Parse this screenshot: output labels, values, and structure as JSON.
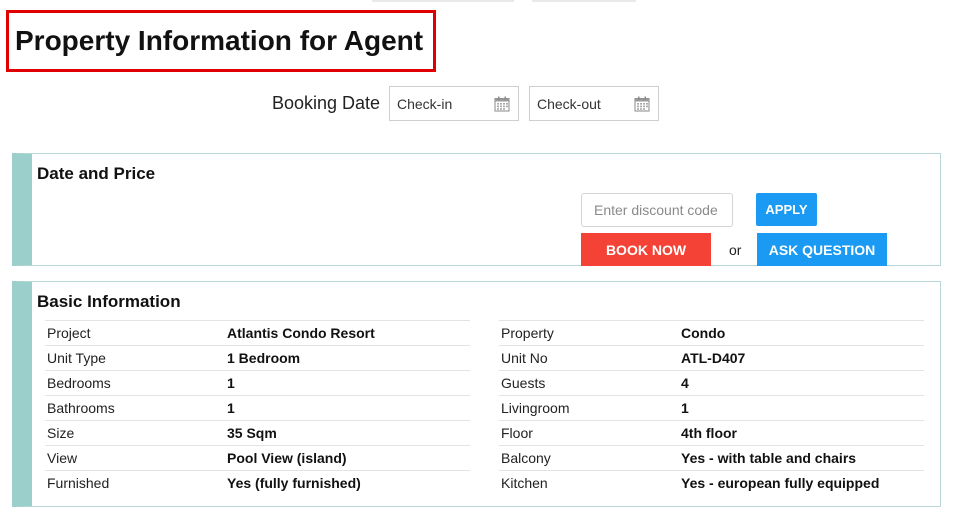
{
  "page": {
    "title": "Property Information for Agent"
  },
  "booking": {
    "label": "Booking Date",
    "checkin": "Check-in",
    "checkout": "Check-out"
  },
  "date_price": {
    "title": "Date and Price",
    "discount_placeholder": "Enter discount code",
    "apply_label": "APPLY",
    "book_label": "BOOK NOW",
    "or_label": "or",
    "ask_label": "ASK QUESTION"
  },
  "basic_info": {
    "title": "Basic Information",
    "left_rows": [
      {
        "label": "Project",
        "value": "Atlantis Condo Resort"
      },
      {
        "label": "Unit Type",
        "value": "1 Bedroom"
      },
      {
        "label": "Bedrooms",
        "value": "1"
      },
      {
        "label": "Bathrooms",
        "value": "1"
      },
      {
        "label": "Size",
        "value": "35 Sqm"
      },
      {
        "label": "View",
        "value": "Pool View (island)"
      },
      {
        "label": "Furnished",
        "value": "Yes (fully furnished)"
      }
    ],
    "right_rows": [
      {
        "label": "Property",
        "value": "Condo"
      },
      {
        "label": "Unit No",
        "value": "ATL-D407"
      },
      {
        "label": "Guests",
        "value": "4"
      },
      {
        "label": "Livingroom",
        "value": "1"
      },
      {
        "label": "Floor",
        "value": "4th floor"
      },
      {
        "label": "Balcony",
        "value": "Yes - with table and chairs"
      },
      {
        "label": "Kitchen",
        "value": "Yes - european fully equipped"
      }
    ]
  },
  "icons": {
    "checkin_icon": "calendar-icon",
    "checkout_icon": "calendar-icon"
  },
  "colors": {
    "title_border": "#e00000",
    "panel_accent": "#9acfcb",
    "primary_button": "#1a9af2",
    "book_button": "#f44336"
  }
}
